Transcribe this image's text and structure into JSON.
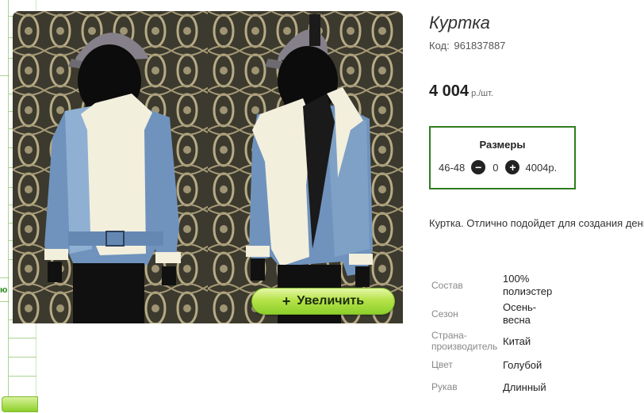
{
  "product": {
    "title": "Куртка",
    "code_label": "Код:",
    "code_value": "961837887",
    "price_value": "4 004",
    "price_unit": "р./шт.",
    "description": "Куртка. Отлично подойдет для создания день."
  },
  "gallery": {
    "zoom_plus": "+",
    "zoom_label": "Увеличить"
  },
  "sizes": {
    "title": "Размеры",
    "size": "46-48",
    "minus_icon": "−",
    "qty": "0",
    "plus_icon": "+",
    "price": "4004р."
  },
  "properties": [
    {
      "key": "Состав",
      "value": "100% полиэстер"
    },
    {
      "key": "Сезон",
      "value": "Осень-весна"
    },
    {
      "key": "Страна-производитель",
      "value": "Китай"
    },
    {
      "key": "Цвет",
      "value": "Голубой"
    },
    {
      "key": "Рукав",
      "value": "Длинный"
    }
  ],
  "sidebar": {
    "fragment_text": "ю"
  },
  "colors": {
    "accent_green": "#2f7d1f",
    "button_green": "#8ccf2a"
  }
}
